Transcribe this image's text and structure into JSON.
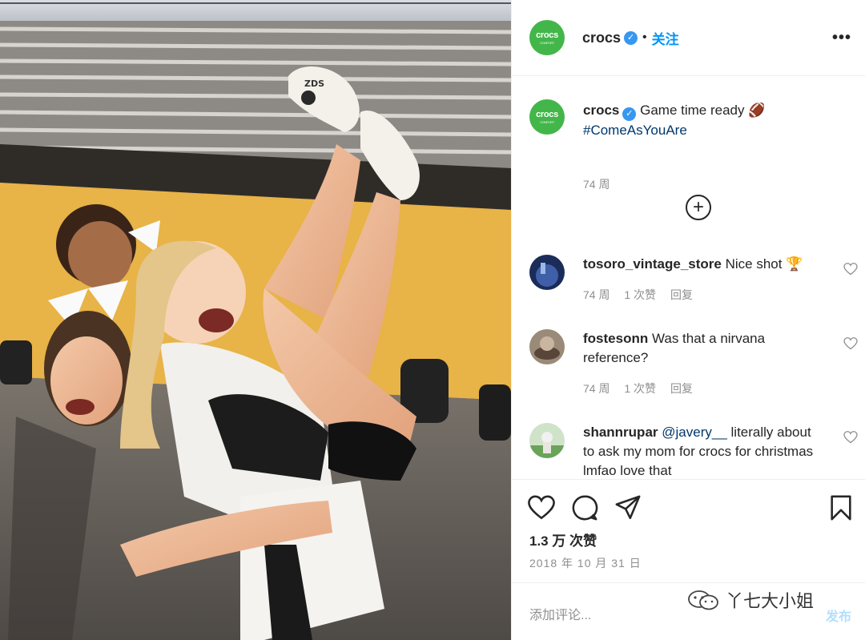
{
  "header": {
    "username": "crocs",
    "separator": "•",
    "follow_label": "关注",
    "more_label": "•••",
    "logo_text": "crocs",
    "logo_subtext": "COMFORT"
  },
  "caption": {
    "username": "crocs",
    "text": "Game time ready 🏈",
    "hashtag": "#ComeAsYouAre",
    "time": "74 周"
  },
  "load_more_label": "+",
  "comments": [
    {
      "username": "tosoro_vintage_store",
      "text": "Nice shot 🏆",
      "time": "74 周",
      "likes": "1 次赞",
      "reply": "回复"
    },
    {
      "username": "fostesonn",
      "text": "Was that a nirvana reference?",
      "time": "74 周",
      "likes": "1 次赞",
      "reply": "回复"
    },
    {
      "username": "shannrupar",
      "mention": "@javery__",
      "text": "literally about to ask my mom for crocs for christmas lmfao love that"
    }
  ],
  "post": {
    "likes": "1.3 万 次赞",
    "date": "2018 年 10 月 31 日"
  },
  "add_comment": {
    "placeholder": "添加评论...",
    "post_label": "发布"
  },
  "watermark": "丫七大小姐",
  "icons": [
    "heart-icon",
    "comment-icon",
    "share-icon",
    "bookmark-icon",
    "add-circle-icon",
    "verified-badge-icon",
    "more-options-icon"
  ],
  "colors": {
    "brand_green": "#43b649",
    "verified_blue": "#3897f0",
    "link_blue": "#0095f6",
    "hashtag": "#00376b",
    "secondary_text": "#8e8e8e"
  }
}
